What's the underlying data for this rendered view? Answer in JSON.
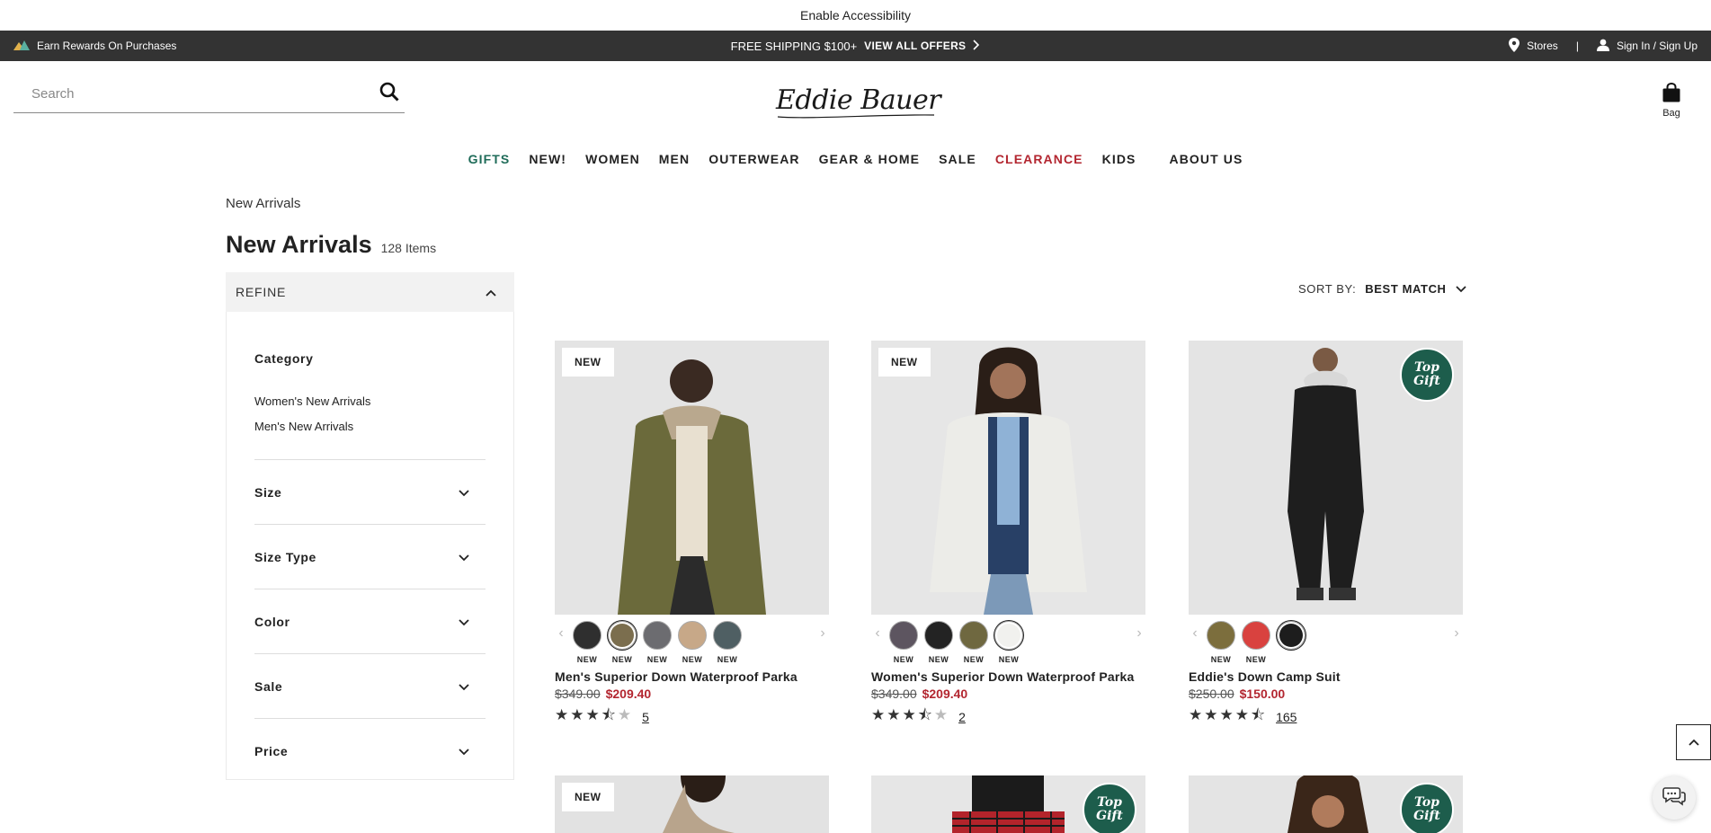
{
  "accessibility": {
    "label": "Enable Accessibility"
  },
  "promo_bar": {
    "rewards": "Earn Rewards On Purchases",
    "shipping": "FREE SHIPPING $100+",
    "offers": "VIEW ALL OFFERS",
    "stores": "Stores",
    "separator": "|",
    "signin": "Sign In / Sign Up"
  },
  "header": {
    "search_placeholder": "Search",
    "logo": "Eddie Bauer",
    "bag": "Bag"
  },
  "nav": [
    "GIFTS",
    "NEW!",
    "WOMEN",
    "MEN",
    "OUTERWEAR",
    "GEAR & HOME",
    "SALE",
    "CLEARANCE",
    "KIDS",
    "ABOUT US"
  ],
  "breadcrumb": "New Arrivals",
  "page": {
    "title": "New Arrivals",
    "count": "128 Items"
  },
  "refine": {
    "label": "REFINE",
    "category_title": "Category",
    "categories": [
      "Women's New Arrivals",
      "Men's New Arrivals"
    ],
    "facets": [
      "Size",
      "Size Type",
      "Color",
      "Sale",
      "Price"
    ]
  },
  "sort": {
    "label": "SORT BY:",
    "value": "BEST MATCH"
  },
  "products": [
    {
      "badge": "NEW",
      "swatches": [
        {
          "color": "#2f2f2f",
          "label": "NEW"
        },
        {
          "color": "#7b6e4e",
          "label": "NEW",
          "selected": true
        },
        {
          "color": "#6c6c70",
          "label": "NEW"
        },
        {
          "color": "#c7a888",
          "label": "NEW"
        },
        {
          "color": "#4f5f63",
          "label": "NEW"
        }
      ],
      "name": "Men's Superior Down Waterproof Parka",
      "old_price": "$349.00",
      "sale_price": "$209.40",
      "rating": 3.5,
      "reviews": "5"
    },
    {
      "badge": "NEW",
      "swatches": [
        {
          "color": "#5d5560",
          "label": "NEW"
        },
        {
          "color": "#232323",
          "label": "NEW"
        },
        {
          "color": "#6f6840",
          "label": "NEW"
        },
        {
          "color": "#f1f1ee",
          "label": "NEW",
          "selected": true
        }
      ],
      "name": "Women's Superior Down Waterproof Parka",
      "old_price": "$349.00",
      "sale_price": "$209.40",
      "rating": 3.5,
      "reviews": "2"
    },
    {
      "gift_badge": "Top Gift",
      "swatches": [
        {
          "color": "#7c6e3d",
          "label": "NEW"
        },
        {
          "color": "#d9423f",
          "label": "NEW"
        },
        {
          "color": "#1d1d1d",
          "label": "",
          "selected": true
        }
      ],
      "name": "Eddie's Down Camp Suit",
      "old_price": "$250.00",
      "sale_price": "$150.00",
      "rating": 4.5,
      "reviews": "165"
    }
  ],
  "row2": [
    {
      "badge": "NEW"
    },
    {
      "gift_badge": "Top Gift"
    },
    {
      "gift_badge": "Top Gift"
    }
  ]
}
